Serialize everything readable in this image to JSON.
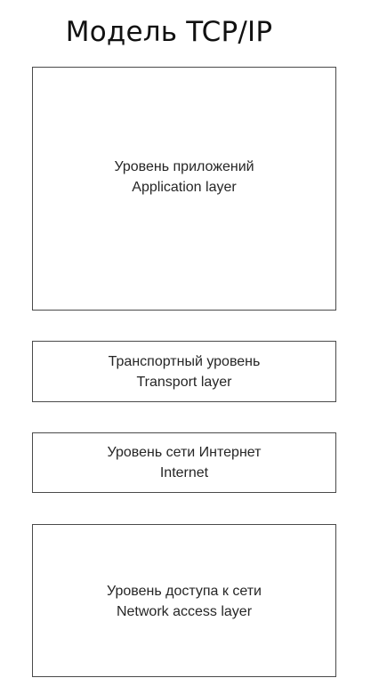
{
  "diagram": {
    "title": "Модель TCP/IP",
    "layers": [
      {
        "name_ru": "Уровень приложений",
        "name_en": "Application layer"
      },
      {
        "name_ru": "Транспортный уровень",
        "name_en": "Transport layer"
      },
      {
        "name_ru": "Уровень сети Интернет",
        "name_en": "Internet"
      },
      {
        "name_ru": "Уровень доступа к сети",
        "name_en": "Network access layer"
      }
    ],
    "colors": {
      "background": "#ffffff",
      "border": "#4a4a4a",
      "text": "#262626"
    }
  }
}
